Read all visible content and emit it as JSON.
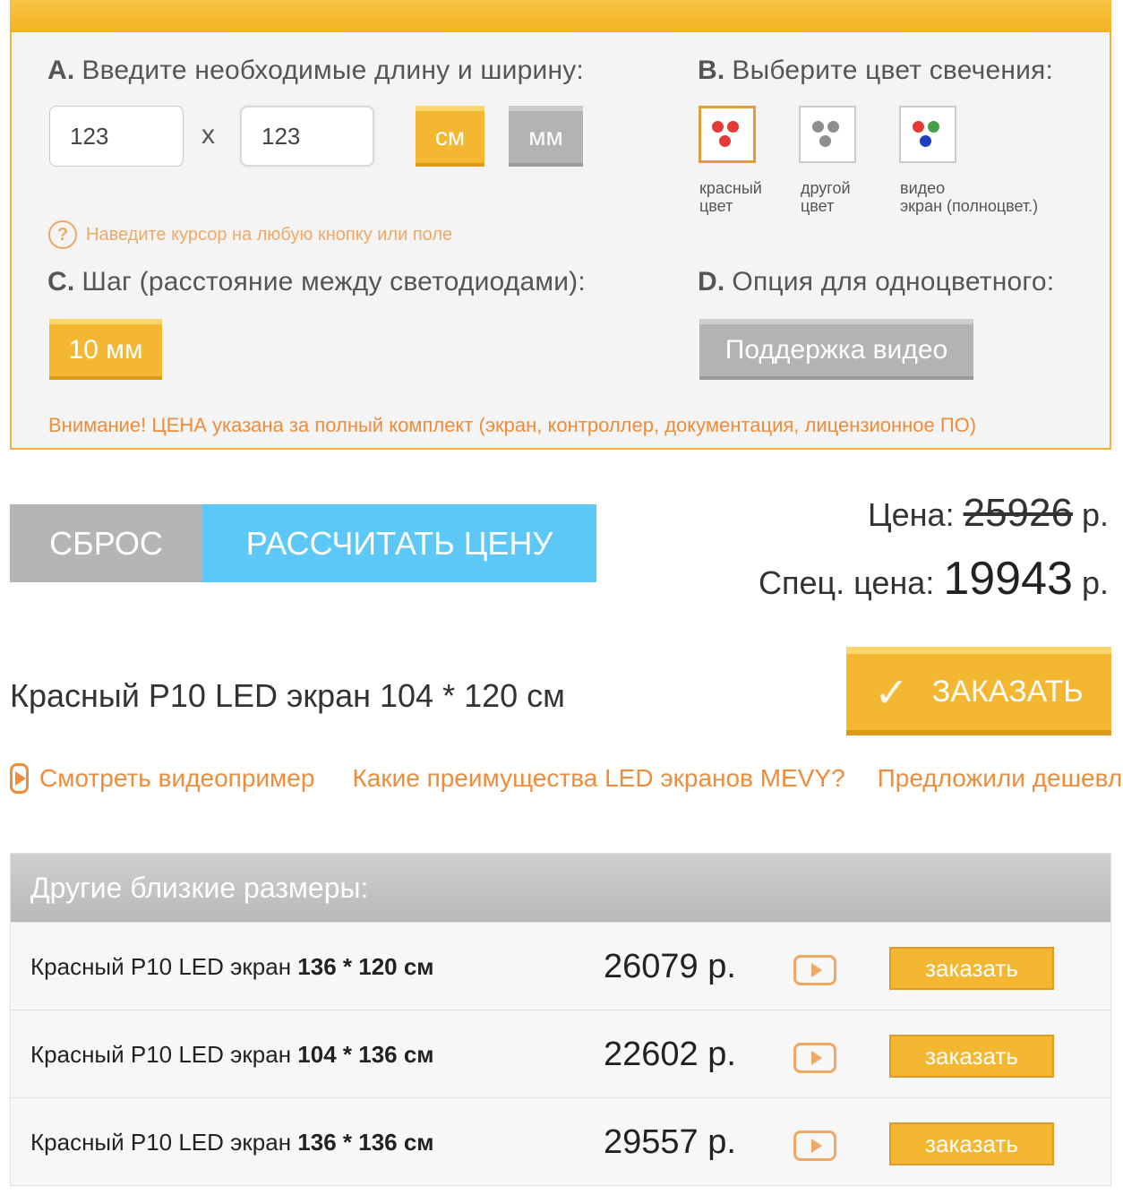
{
  "section_a": {
    "letter": "A.",
    "title": "Введите необходимые длину и ширину:",
    "length_value": "123",
    "width_value": "123",
    "times": "x",
    "unit_cm": "см",
    "unit_mm": "мм",
    "selected_unit": "см"
  },
  "section_b": {
    "letter": "B.",
    "title": "Выберите цвет свечения:",
    "options": [
      {
        "label_line1": "красный",
        "label_line2": "цвет",
        "dots": [
          "#e53935",
          "#e53935",
          "#e53935"
        ],
        "selected": true
      },
      {
        "label_line1": "другой",
        "label_line2": "цвет",
        "dots": [
          "#8e8e8e",
          "#8e8e8e",
          "#8e8e8e"
        ],
        "selected": false
      },
      {
        "label_line1": "видео",
        "label_line2": "экран (полноцвет.)",
        "dots": [
          "#e53935",
          "#43a047",
          "#1e3fbf"
        ],
        "selected": false
      }
    ]
  },
  "hint": {
    "icon": "?",
    "text": "Наведите курсор на любую кнопку или поле"
  },
  "section_c": {
    "letter": "C.",
    "title": "Шаг (расстояние между светодиодами):",
    "pitch_button": "10 мм"
  },
  "section_d": {
    "letter": "D.",
    "title": "Опция для одноцветного:",
    "option_button": "Поддержка видео"
  },
  "notice": "Внимание! ЦЕНА указана за полный комплект (экран, контроллер, документация, лицензионное ПО)",
  "actions": {
    "reset": "СБРОС",
    "calculate": "РАССЧИТАТЬ ЦЕНУ"
  },
  "pricing": {
    "price_label": "Цена:",
    "old_price": "25926",
    "currency": "р.",
    "special_label": "Спец. цена:",
    "special_price": "19943"
  },
  "product": {
    "title": "Красный P10 LED экран 104 * 120 см",
    "order_button": "ЗАКАЗАТЬ"
  },
  "links": {
    "video": "Смотреть видеопример",
    "advantages": "Какие преимущества LED экранов MEVY?",
    "cheaper": "Предложили дешевле?"
  },
  "similar": {
    "title": "Другие близкие размеры:",
    "rows": [
      {
        "name_prefix": "Красный P10 LED экран ",
        "size": "136 * 120 см",
        "price": "26079 р.",
        "button": "заказать"
      },
      {
        "name_prefix": "Красный P10 LED экран ",
        "size": "104 * 136 см",
        "price": "22602 р.",
        "button": "заказать"
      },
      {
        "name_prefix": "Красный P10 LED экран ",
        "size": "136 * 136 см",
        "price": "29557 р.",
        "button": "заказать"
      }
    ]
  },
  "colors": {
    "accent_orange": "#f4b732",
    "link_orange": "#ef8c3a",
    "calc_blue": "#5dc8f7",
    "gray_button": "#b5b5b5"
  }
}
